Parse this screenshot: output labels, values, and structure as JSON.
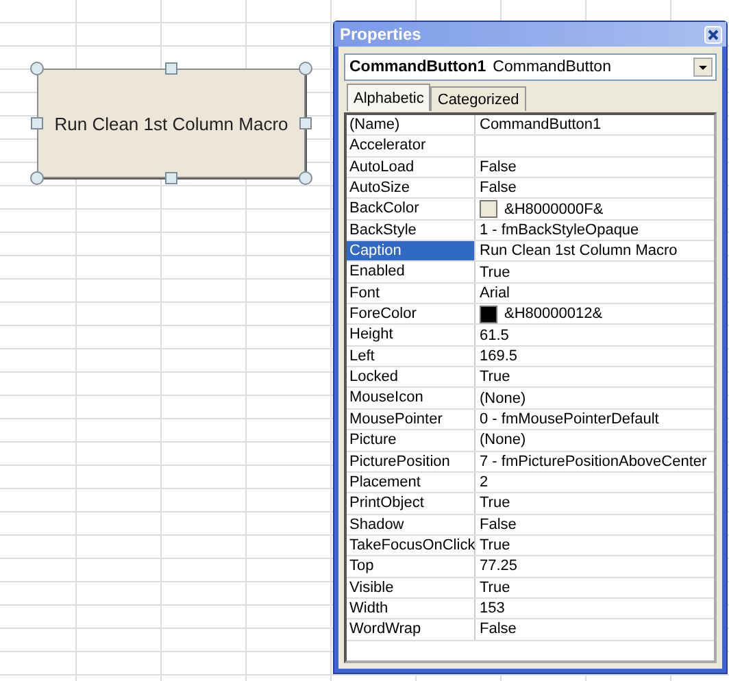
{
  "sheet_button": {
    "caption": "Run Clean 1st Column Macro",
    "selected": true
  },
  "properties": {
    "title": "Properties",
    "object_selector": {
      "name": "CommandButton1",
      "type": "CommandButton"
    },
    "tabs": [
      {
        "label": "Alphabetic",
        "selected": true
      },
      {
        "label": "Categorized",
        "selected": false
      }
    ],
    "rows": [
      {
        "name": "(Name)",
        "value": "CommandButton1",
        "selected": false
      },
      {
        "name": "Accelerator",
        "selected": false
      },
      {
        "name": "AutoLoad",
        "value": "False",
        "selected": false
      },
      {
        "name": "AutoSize",
        "value": "False",
        "selected": false
      },
      {
        "name": "BackColor",
        "value": "&H8000000F&",
        "color": "#ece9d8",
        "selected": false
      },
      {
        "name": "BackStyle",
        "value": "1 - fmBackStyleOpaque",
        "selected": false
      },
      {
        "name": "Caption",
        "value": "Run Clean 1st Column Macro",
        "selected": true
      },
      {
        "name": "Enabled",
        "value": "True",
        "selected": false
      },
      {
        "name": "Font",
        "value": "Arial",
        "selected": false
      },
      {
        "name": "ForeColor",
        "value": "&H80000012&",
        "color": "#000000",
        "selected": false
      },
      {
        "name": "Height",
        "value": "61.5",
        "selected": false
      },
      {
        "name": "Left",
        "value": "169.5",
        "selected": false
      },
      {
        "name": "Locked",
        "value": "True",
        "selected": false
      },
      {
        "name": "MouseIcon",
        "value": "(None)",
        "selected": false
      },
      {
        "name": "MousePointer",
        "value": "0 - fmMousePointerDefault",
        "selected": false
      },
      {
        "name": "Picture",
        "value": "(None)",
        "selected": false
      },
      {
        "name": "PicturePosition",
        "value": "7 - fmPicturePositionAboveCenter",
        "selected": false
      },
      {
        "name": "Placement",
        "value": "2",
        "selected": false
      },
      {
        "name": "PrintObject",
        "value": "True",
        "selected": false
      },
      {
        "name": "Shadow",
        "value": "False",
        "selected": false
      },
      {
        "name": "TakeFocusOnClick",
        "value": "True",
        "selected": false
      },
      {
        "name": "Top",
        "value": "77.25",
        "selected": false
      },
      {
        "name": "Visible",
        "value": "True",
        "selected": false
      },
      {
        "name": "Width",
        "value": "153",
        "selected": false
      },
      {
        "name": "WordWrap",
        "value": "False",
        "selected": false
      }
    ]
  }
}
